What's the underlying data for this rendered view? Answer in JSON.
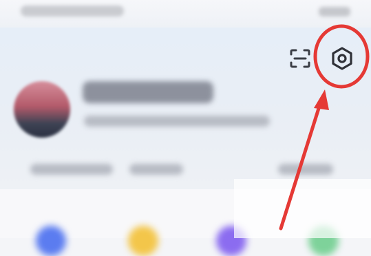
{
  "app": {
    "status_bar": {
      "left_text": "",
      "right_text": ""
    },
    "header": {
      "scan_icon": "scan-icon",
      "settings_icon": "settings-hex-gear-icon"
    },
    "profile": {
      "name": "",
      "meta": ""
    },
    "annotation": {
      "type": "red-circle-with-arrow",
      "target": "settings-button",
      "color": "#e53935"
    },
    "colors": {
      "header_background": "#e8eef7",
      "annotation_red": "#e53935",
      "avatar_primary": "#b35a6a"
    }
  }
}
